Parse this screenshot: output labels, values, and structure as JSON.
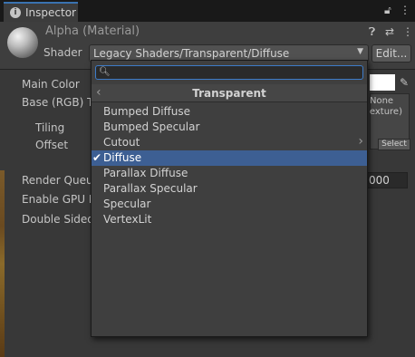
{
  "window": {
    "tab_title": "Inspector",
    "tab_icon": "info-icon",
    "lock_icon": "lock-icon",
    "menu_icon": "kebab-menu-icon"
  },
  "material": {
    "title": "Alpha (Material)",
    "preview_icon": "material-sphere-preview",
    "help_icon": "help-icon",
    "settings_icon": "preset-settings-icon",
    "menu_icon": "kebab-menu-icon",
    "shader_label": "Shader",
    "shader_value": "Legacy Shaders/Transparent/Diffuse",
    "edit_label": "Edit..."
  },
  "properties": {
    "main_color": "Main Color",
    "main_color_value": "#ffffff",
    "base_label": "Base (RGB) T",
    "tiling": "Tiling",
    "offset": "Offset",
    "texture_none": "None",
    "texture_type": "exture)",
    "select_label": "Select",
    "render_queue": "Render Queue",
    "render_queue_value": "000",
    "gpu_instancing": "Enable GPU In",
    "double_sided": "Double Sided"
  },
  "popup": {
    "search_placeholder": "",
    "breadcrumb": "Transparent",
    "items": [
      {
        "label": "Bumped Diffuse",
        "selected": false,
        "submenu": false
      },
      {
        "label": "Bumped Specular",
        "selected": false,
        "submenu": false
      },
      {
        "label": "Cutout",
        "selected": false,
        "submenu": true
      },
      {
        "label": "Diffuse",
        "selected": true,
        "submenu": false
      },
      {
        "label": "Parallax Diffuse",
        "selected": false,
        "submenu": false
      },
      {
        "label": "Parallax Specular",
        "selected": false,
        "submenu": false
      },
      {
        "label": "Specular",
        "selected": false,
        "submenu": false
      },
      {
        "label": "VertexLit",
        "selected": false,
        "submenu": false
      }
    ]
  },
  "colors": {
    "accent": "#3a72b0",
    "selection": "#3d5f93",
    "panel": "#383838"
  }
}
